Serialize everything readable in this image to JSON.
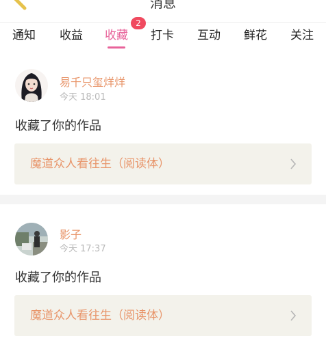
{
  "header": {
    "title": "消息"
  },
  "tabs": [
    {
      "label": "通知",
      "active": false
    },
    {
      "label": "收益",
      "active": false
    },
    {
      "label": "收藏",
      "active": true,
      "badge": "2"
    },
    {
      "label": "打卡",
      "active": false
    },
    {
      "label": "互动",
      "active": false
    },
    {
      "label": "鲜花",
      "active": false
    },
    {
      "label": "关注",
      "active": false
    }
  ],
  "notifications": [
    {
      "user": "易千只玺烊烊",
      "time": "今天 18:01",
      "action": "收藏了你的作品",
      "work_title": "魔道众人看往生（阅读体）",
      "avatar_icon": "anime-girl-avatar"
    },
    {
      "user": "影子",
      "time": "今天 17:37",
      "action": "收藏了你的作品",
      "work_title": "魔道众人看往生（阅读体）",
      "avatar_icon": "outdoor-photo-avatar"
    }
  ],
  "colors": {
    "accent": "#e8639a",
    "badge": "#f04a5f",
    "name": "#e8956a",
    "box": "#f3f2eb"
  }
}
